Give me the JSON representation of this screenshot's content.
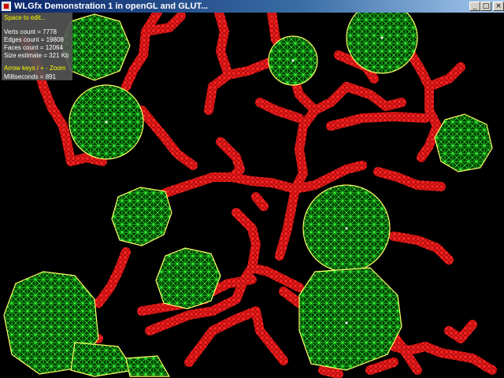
{
  "window": {
    "title": "WLGfx Demonstration 1 in openGL and GLUT...",
    "icon": "app-window-icon",
    "buttons": {
      "minimize": "_",
      "maximize": "□",
      "close": "×"
    }
  },
  "overlay": {
    "edit_hint": "Space to edit...",
    "verts": "Verts count = 7778",
    "edges": "Edges count = 19808",
    "faces": "Faces count = 12064",
    "size": "Size estimate = 321 Kb",
    "zoom_hint": "Arrow keys / + - Zoom",
    "timing": "Milliseconds = 891"
  },
  "colors": {
    "background": "#000000",
    "branch_mesh": "#ff2a2a",
    "branch_fill": "#a00000",
    "node_mesh": "#33ff33",
    "node_fill": "#004400",
    "node_outline": "#ffff66"
  }
}
